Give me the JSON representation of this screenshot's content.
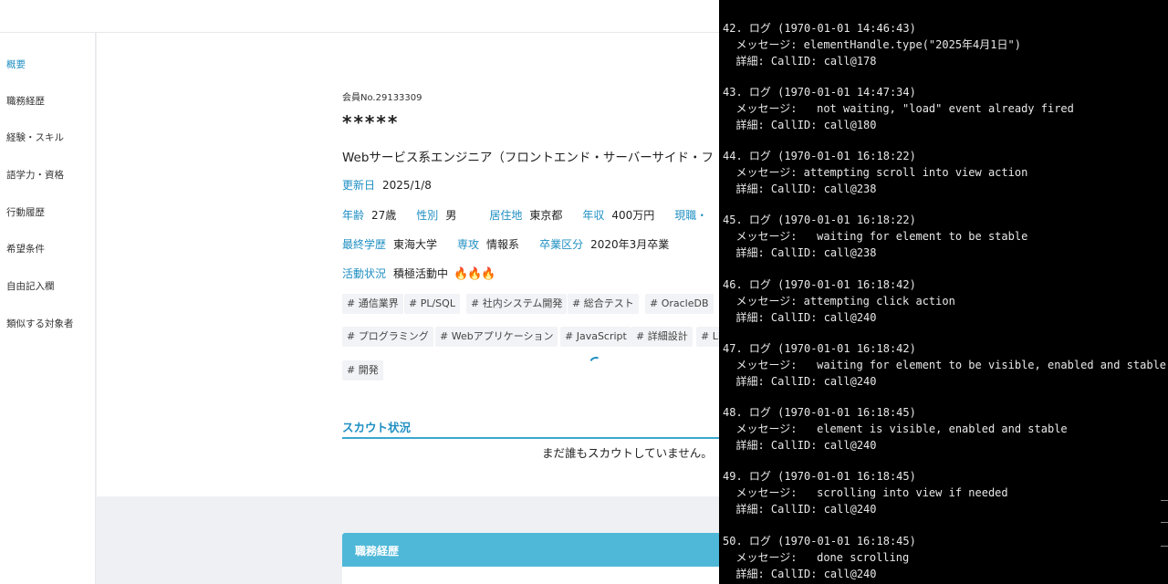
{
  "nav": {
    "items": [
      {
        "label": "概要",
        "active": true
      },
      {
        "label": "職務経歴"
      },
      {
        "label": "経験・スキル"
      },
      {
        "label": "語学力・資格"
      },
      {
        "label": "行動履歴"
      },
      {
        "label": "希望条件"
      },
      {
        "label": "自由記入欄"
      },
      {
        "label": "類似する対象者"
      }
    ]
  },
  "profile": {
    "member_no": "会員No.29133309",
    "name": "*****",
    "job_title": "Webサービス系エンジニア（フロントエンド・サーバーサイド・フ",
    "updated_label": "更新日",
    "updated_value": "2025/1/8",
    "age_label": "年齢",
    "age_value": "27歳",
    "gender_label": "性別",
    "gender_value": "男",
    "residence_label": "居住地",
    "residence_value": "東京都",
    "income_label": "年収",
    "income_value": "400万円",
    "current_label": "現職・",
    "education_label": "最終学歴",
    "education_value": "東海大学",
    "major_label": "専攻",
    "major_value": "情報系",
    "graduation_label": "卒業区分",
    "graduation_value": "2020年3月卒業",
    "activity_label": "活動状況",
    "activity_value": "積極活動中",
    "activity_flames": "🔥🔥🔥",
    "tags": [
      "# 通信業界",
      "# PL/SQL",
      "# 社内システム開発",
      "# 総合テスト",
      "# OracleDB",
      "# プログラミング",
      "# Webアプリケーション",
      "# JavaScript",
      "# 詳細設計",
      "# Li",
      "# 開発"
    ]
  },
  "scout": {
    "heading": "スカウト状況",
    "empty_message": "まだ誰もスカウトしていません。"
  },
  "career": {
    "heading": "職務経歴"
  },
  "console": {
    "entries": [
      {
        "header": "42. ログ (1970-01-01 14:46:43)",
        "message": "  メッセージ: elementHandle.type(\"2025年4月1日\")",
        "detail": "  詳細: CallID: call@178"
      },
      {
        "header": "43. ログ (1970-01-01 14:47:34)",
        "message": "  メッセージ:   not waiting, \"load\" event already fired",
        "detail": "  詳細: CallID: call@180"
      },
      {
        "header": "44. ログ (1970-01-01 16:18:22)",
        "message": "  メッセージ: attempting scroll into view action",
        "detail": "  詳細: CallID: call@238"
      },
      {
        "header": "45. ログ (1970-01-01 16:18:22)",
        "message": "  メッセージ:   waiting for element to be stable",
        "detail": "  詳細: CallID: call@238"
      },
      {
        "header": "46. ログ (1970-01-01 16:18:42)",
        "message": "  メッセージ: attempting click action",
        "detail": "  詳細: CallID: call@240"
      },
      {
        "header": "47. ログ (1970-01-01 16:18:42)",
        "message": "  メッセージ:   waiting for element to be visible, enabled and stable",
        "detail": "  詳細: CallID: call@240"
      },
      {
        "header": "48. ログ (1970-01-01 16:18:45)",
        "message": "  メッセージ:   element is visible, enabled and stable",
        "detail": "  詳細: CallID: call@240"
      },
      {
        "header": "49. ログ (1970-01-01 16:18:45)",
        "message": "  メッセージ:   scrolling into view if needed",
        "detail": "  詳細: CallID: call@240"
      },
      {
        "header": "50. ログ (1970-01-01 16:18:45)",
        "message": "  メッセージ:   done scrolling",
        "detail": "  詳細: CallID: call@240"
      }
    ]
  }
}
